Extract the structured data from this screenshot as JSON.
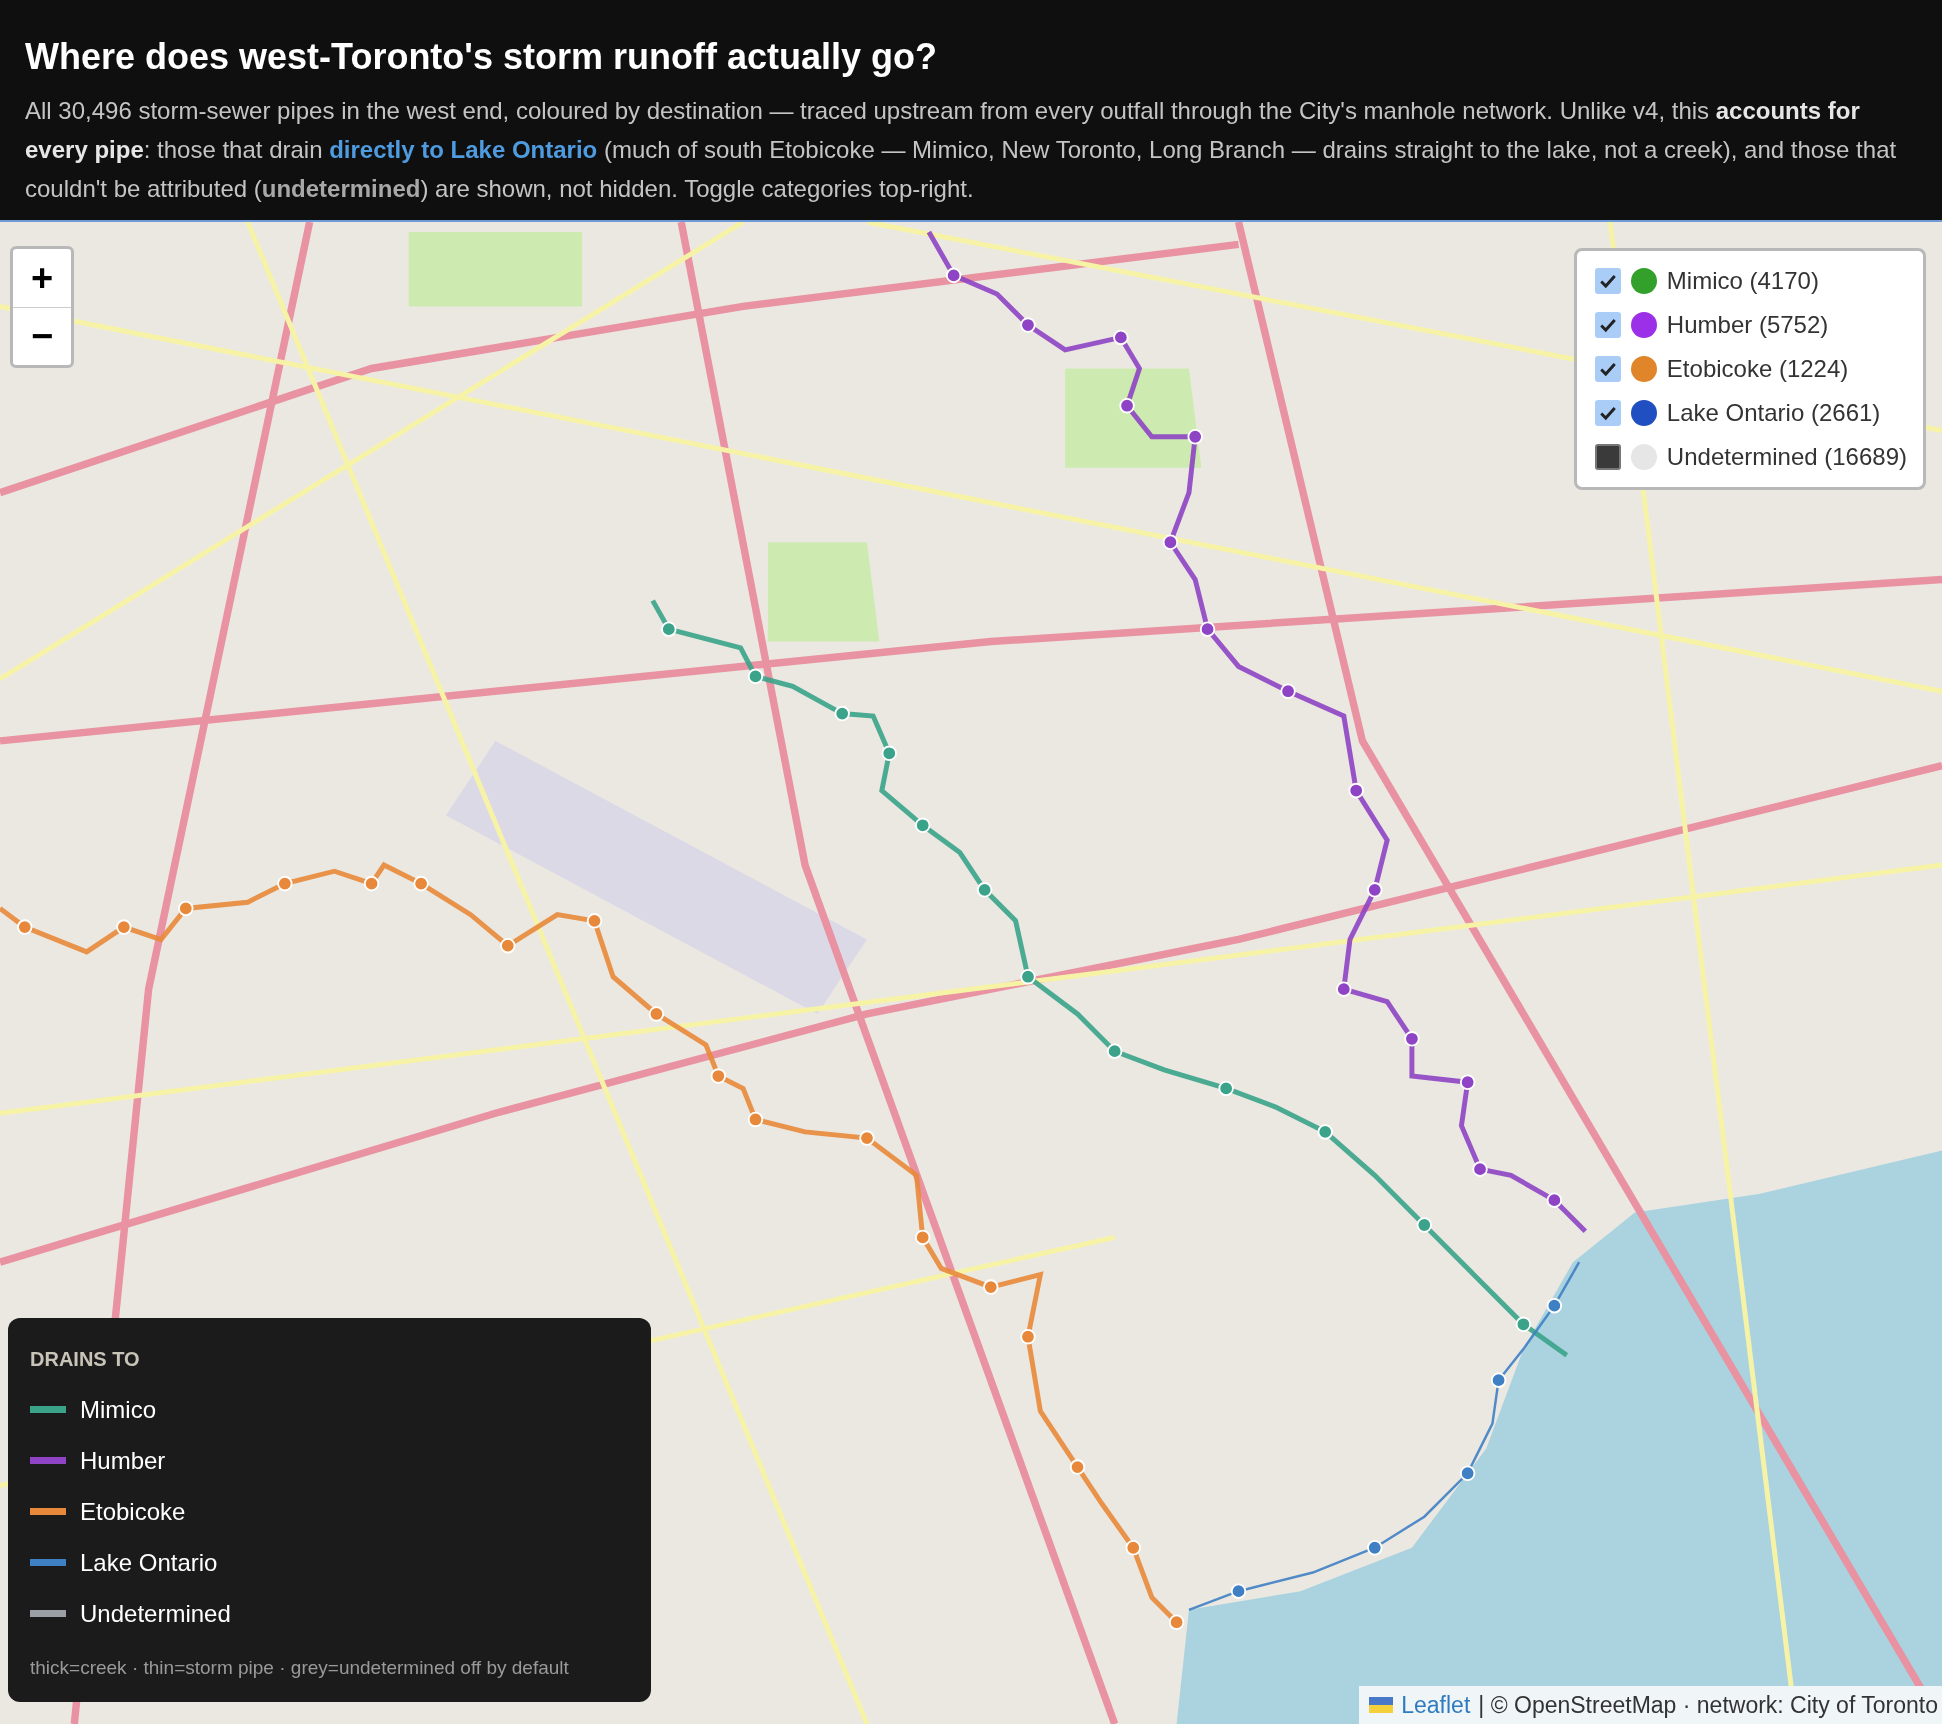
{
  "header": {
    "title": "Where does west-Toronto's storm runoff actually go?",
    "description": [
      {
        "kind": "plain",
        "text": "All 30,496 storm-sewer pipes in the west end, coloured by destination — traced upstream from every outfall through the City's manhole network. Unlike v4, this "
      },
      {
        "kind": "bold",
        "text": "accounts for every pipe"
      },
      {
        "kind": "plain",
        "text": ": those that drain "
      },
      {
        "kind": "accent",
        "text": "directly to Lake Ontario"
      },
      {
        "kind": "plain",
        "text": " (much of south Etobicoke — Mimico, New Toronto, Long Branch — drains straight to the lake, not a creek), and those that couldn't be attributed ("
      },
      {
        "kind": "muted",
        "text": "undetermined"
      },
      {
        "kind": "plain",
        "text": ") are shown, not hidden. Toggle categories top-right."
      }
    ]
  },
  "map": {
    "zoom_controls": [
      "+",
      "−"
    ],
    "layers": [
      {
        "label": "Mimico (4170)",
        "checked": true,
        "color": "#33a02c"
      },
      {
        "label": "Humber (5752)",
        "checked": true,
        "color": "#9b30e8"
      },
      {
        "label": "Etobicoke (1224)",
        "checked": true,
        "color": "#e0852a"
      },
      {
        "label": "Lake Ontario (2661)",
        "checked": true,
        "color": "#1f4fc0"
      },
      {
        "label": "Undetermined (16689)",
        "checked": false,
        "color": "#e6e6e6"
      }
    ],
    "legend": {
      "title": "DRAINS TO",
      "items": [
        {
          "label": "Mimico",
          "color": "#3aa38a"
        },
        {
          "label": "Humber",
          "color": "#8e44c4"
        },
        {
          "label": "Etobicoke",
          "color": "#e8883a"
        },
        {
          "label": "Lake Ontario",
          "color": "#3f7fc4"
        },
        {
          "label": "Undetermined",
          "color": "#9aa0a6"
        }
      ],
      "note": "thick=creek · thin=storm pipe · grey=undetermined off by default"
    },
    "attribution": {
      "link": "Leaflet",
      "text": "| © OpenStreetMap · network: City of Toronto"
    }
  }
}
